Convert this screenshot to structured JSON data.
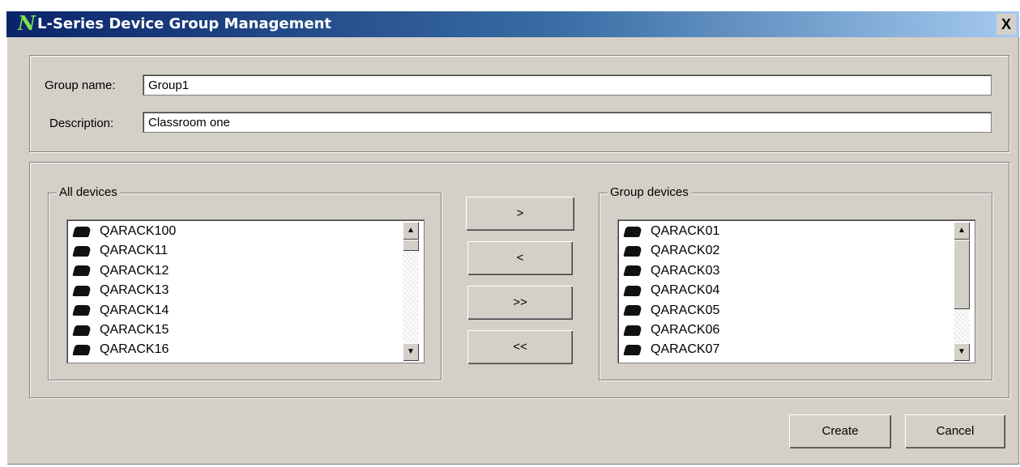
{
  "window": {
    "title": "L-Series Device Group Management",
    "close_label": "X"
  },
  "form": {
    "group_name_label": "Group name:",
    "group_name_value": "Group1",
    "description_label": "Description:",
    "description_value": "Classroom one"
  },
  "all_devices": {
    "label": "All devices",
    "items": [
      "QARACK100",
      "QARACK11",
      "QARACK12",
      "QARACK13",
      "QARACK14",
      "QARACK15",
      "QARACK16"
    ]
  },
  "group_devices": {
    "label": "Group devices",
    "items": [
      "QARACK01",
      "QARACK02",
      "QARACK03",
      "QARACK04",
      "QARACK05",
      "QARACK06",
      "QARACK07"
    ]
  },
  "transfer_buttons": {
    "add_one": ">",
    "remove_one": "<",
    "add_all": ">>",
    "remove_all": "<<"
  },
  "footer": {
    "create_label": "Create",
    "cancel_label": "Cancel"
  }
}
